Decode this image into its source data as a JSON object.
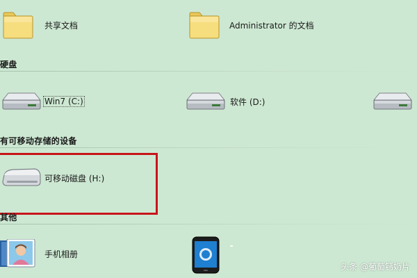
{
  "folders": [
    {
      "label": "共享文档",
      "icon": "folder-icon"
    },
    {
      "label": "Administrator 的文档",
      "icon": "folder-icon"
    }
  ],
  "groups": {
    "hard_disks": {
      "title": "硬盘",
      "drives": [
        {
          "label": "Win7 (C:)",
          "icon": "hard-drive-icon"
        },
        {
          "label": "软件 (D:)",
          "icon": "hard-drive-icon"
        },
        {
          "label": "",
          "icon": "hard-drive-icon"
        }
      ]
    },
    "removable": {
      "title": "有可移动存储的设备",
      "devices": [
        {
          "label": "可移动磁盘 (H:)",
          "icon": "removable-disk-icon"
        }
      ]
    },
    "other": {
      "title": "其他",
      "items": [
        {
          "label": "手机相册",
          "icon": "photo-album-icon"
        },
        {
          "label": "",
          "icon": "phone-device-icon"
        }
      ]
    }
  },
  "watermark": "头条 @葡萄钙奶片",
  "colors": {
    "background": "#cde8d2",
    "highlight": "#c8141a"
  }
}
